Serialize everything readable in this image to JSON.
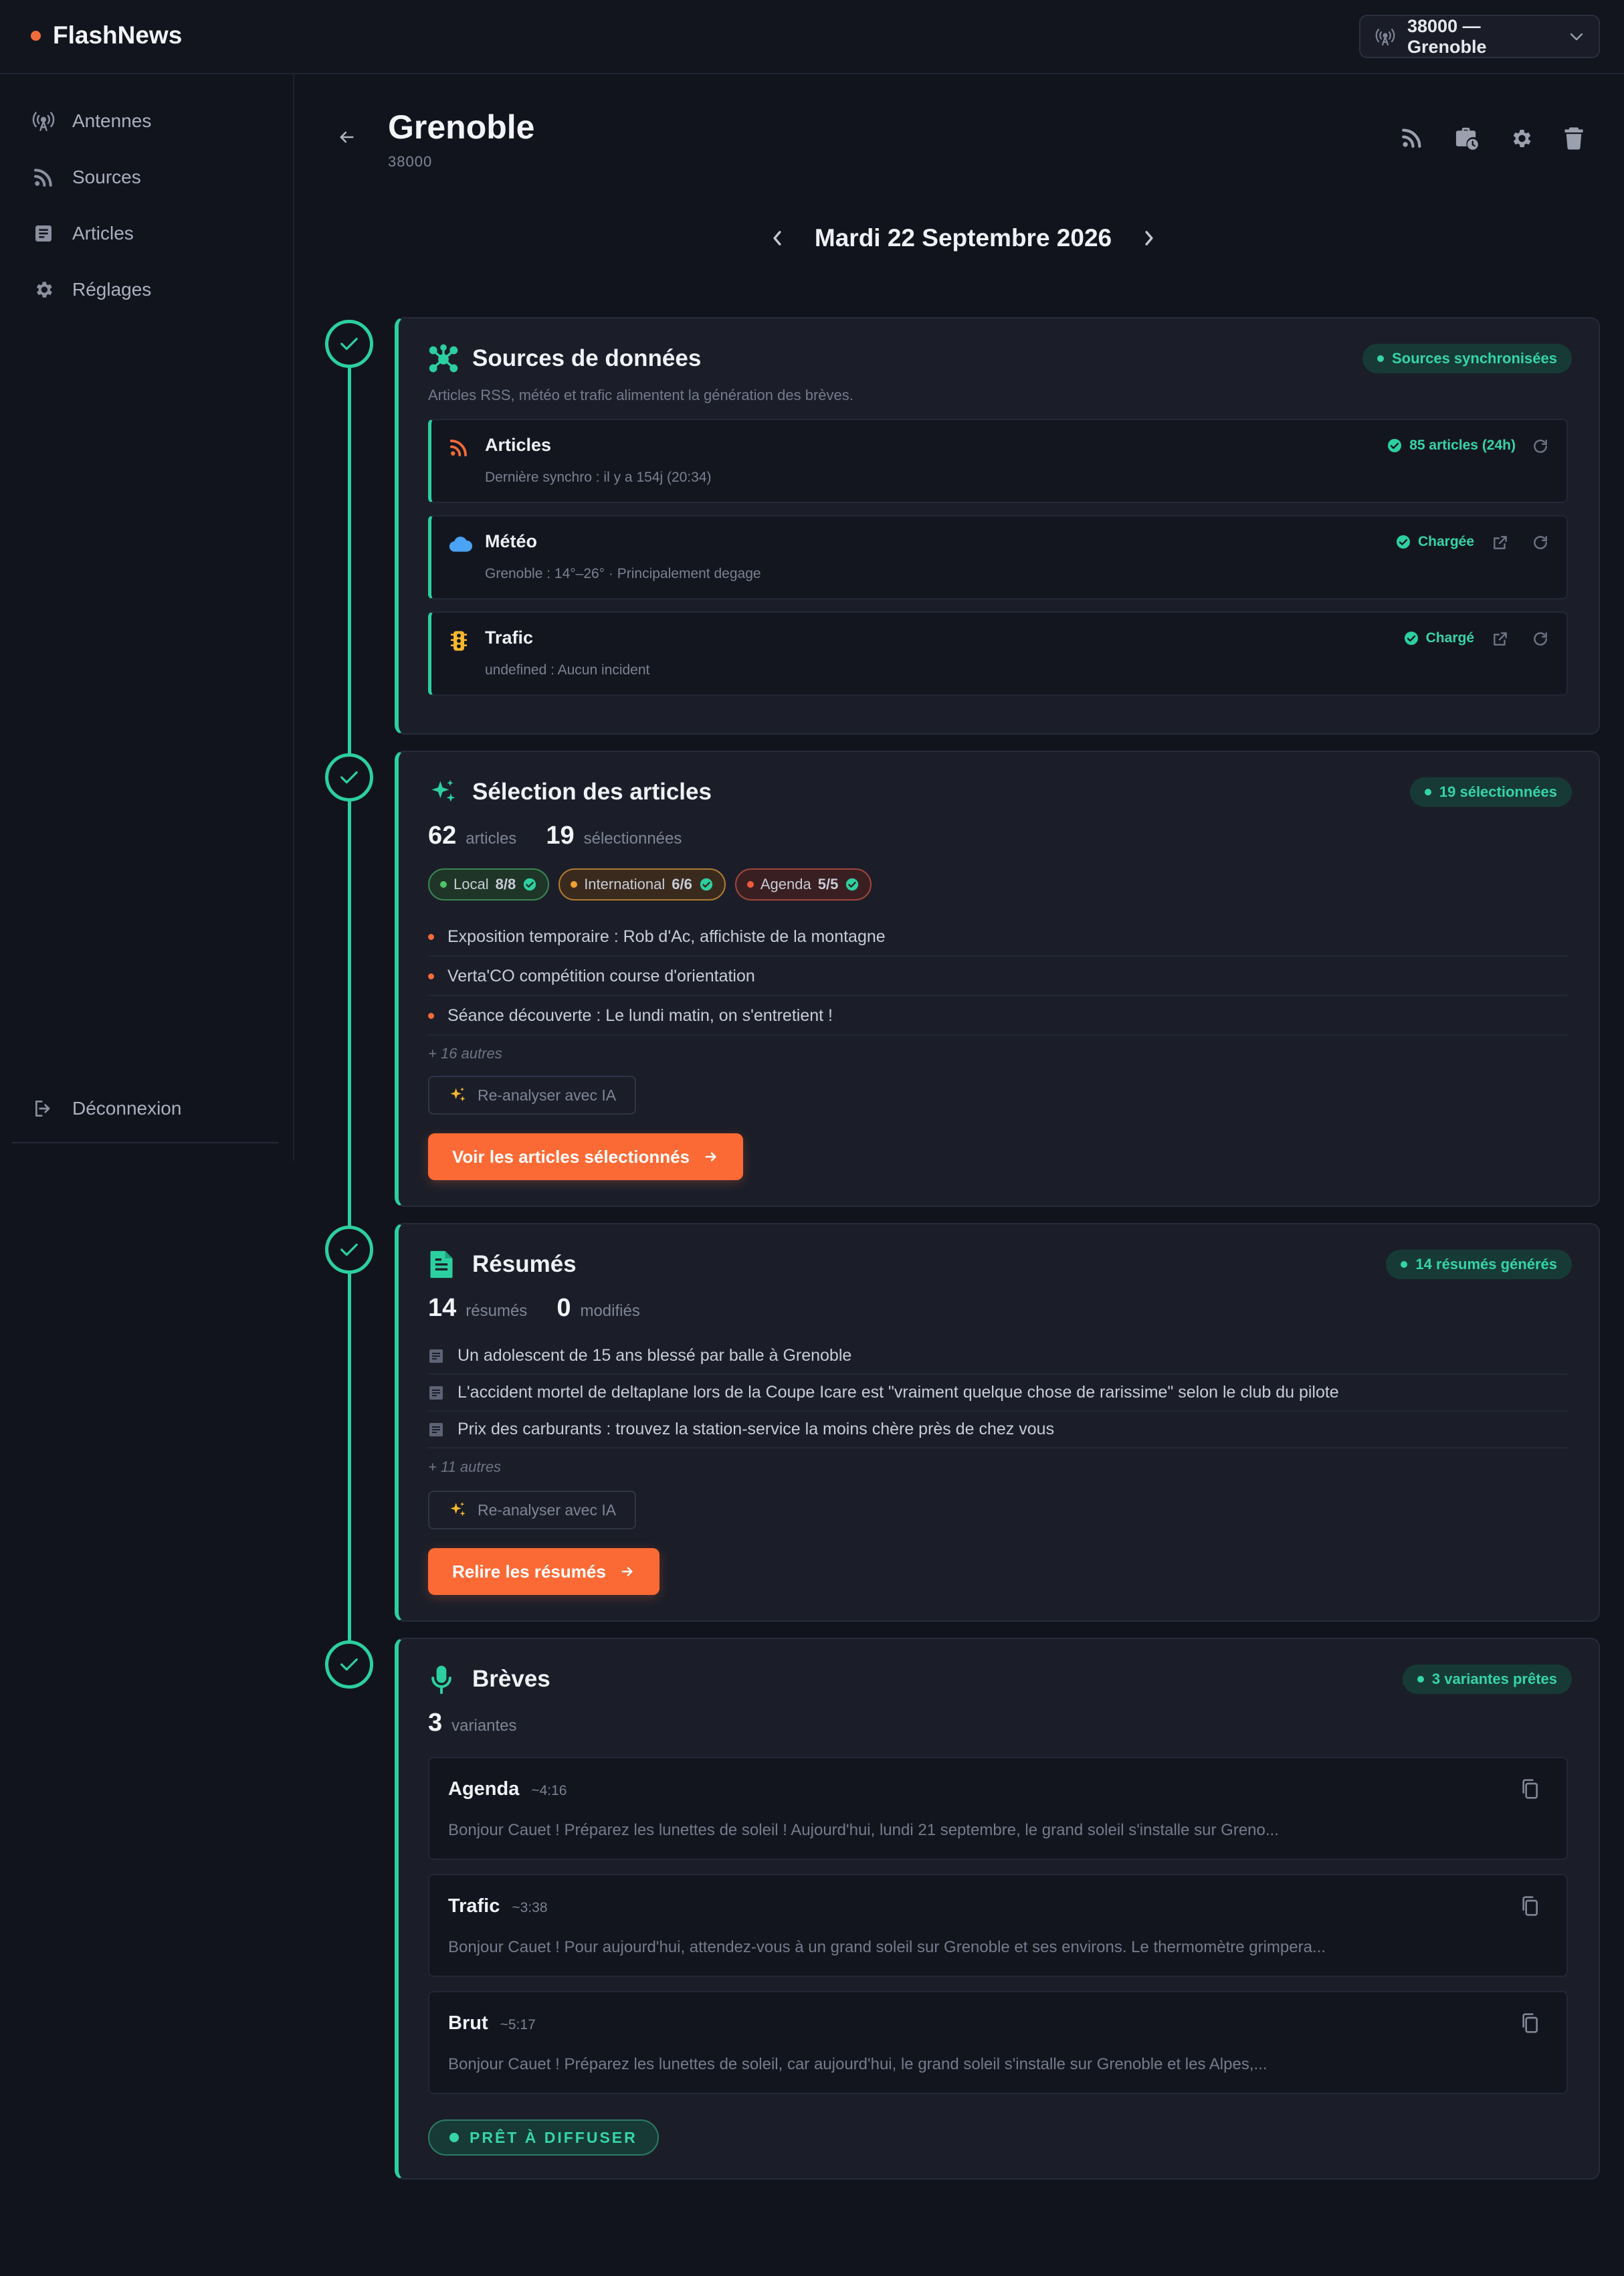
{
  "app": {
    "name": "FlashNews",
    "selector": "38000 — Grenoble"
  },
  "sidebar": {
    "items": [
      {
        "label": "Antennes",
        "icon": "antenna-icon"
      },
      {
        "label": "Sources",
        "icon": "rss-icon"
      },
      {
        "label": "Articles",
        "icon": "article-icon"
      },
      {
        "label": "Réglages",
        "icon": "gear-icon"
      }
    ],
    "logout": "Déconnexion"
  },
  "header": {
    "title": "Grenoble",
    "subtitle": "38000",
    "date": "Mardi 22 Septembre 2026"
  },
  "steps": {
    "sources": {
      "title": "Sources de données",
      "badge": "Sources synchronisées",
      "desc": "Articles RSS, météo et trafic alimentent la génération des brèves.",
      "rows": [
        {
          "name": "Articles",
          "sub": "Dernière synchro : il y a 154j (20:34)",
          "status": "85 articles (24h)"
        },
        {
          "name": "Météo",
          "sub": "Grenoble : 14°–26° · Principalement degage",
          "status": "Chargée"
        },
        {
          "name": "Trafic",
          "sub": "undefined : Aucun incident",
          "status": "Chargé"
        }
      ]
    },
    "selection": {
      "title": "Sélection des articles",
      "badge": "19 sélectionnées",
      "total": "62",
      "total_label": "articles",
      "selected": "19",
      "selected_label": "sélectionnées",
      "pills": [
        {
          "label": "Local",
          "count": "8/8",
          "color": "#4cc46a"
        },
        {
          "label": "International",
          "count": "6/6",
          "color": "#f0a030"
        },
        {
          "label": "Agenda",
          "count": "5/5",
          "color": "#f05a3a"
        }
      ],
      "items": [
        "Exposition temporaire : Rob d'Ac, affichiste de la montagne",
        "Verta'CO compétition course d'orientation",
        "Séance découverte : Le lundi matin, on s'entretient !"
      ],
      "more": "+ 16 autres",
      "reanalyse": "Re-analyser avec IA",
      "cta": "Voir les articles sélectionnés"
    },
    "summaries": {
      "title": "Résumés",
      "badge": "14 résumés générés",
      "count": "14",
      "count_label": "résumés",
      "modified": "0",
      "modified_label": "modifiés",
      "items": [
        "Un adolescent de 15 ans blessé par balle à Grenoble",
        "L'accident mortel de deltaplane lors de la Coupe Icare est \"vraiment quelque chose de rarissime\" selon le club du pilote",
        "Prix des carburants : trouvez la station-service la moins chère près de chez vous"
      ],
      "more": "+ 11 autres",
      "reanalyse": "Re-analyser avec IA",
      "cta": "Relire les résumés"
    },
    "breves": {
      "title": "Brèves",
      "badge": "3 variantes prêtes",
      "count": "3",
      "count_label": "variantes",
      "variants": [
        {
          "name": "Agenda",
          "duration": "~4:16",
          "text": "Bonjour Cauet ! Préparez les lunettes de soleil ! Aujourd'hui, lundi 21 septembre, le grand soleil s'installe sur Greno..."
        },
        {
          "name": "Trafic",
          "duration": "~3:38",
          "text": "Bonjour Cauet ! Pour aujourd'hui, attendez-vous à un grand soleil sur Grenoble et ses environs. Le thermomètre grimpera..."
        },
        {
          "name": "Brut",
          "duration": "~5:17",
          "text": "Bonjour Cauet ! Préparez les lunettes de soleil, car aujourd'hui, le grand soleil s'installe sur Grenoble et les Alpes,..."
        }
      ],
      "ready": "PRÊT À DIFFUSER"
    }
  },
  "colors": {
    "accent": "#2cd0a0",
    "cta": "#fb6a35",
    "brand_dot": "#f26b3a"
  }
}
